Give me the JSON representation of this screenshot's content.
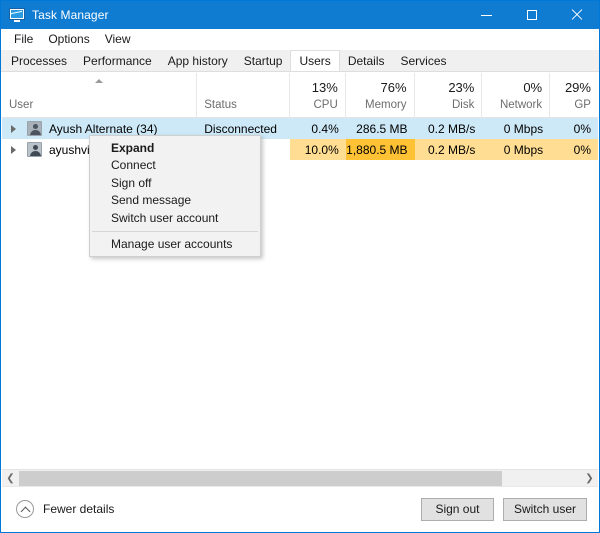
{
  "window": {
    "title": "Task Manager",
    "icon": "task-manager-icon",
    "controls": {
      "minimize": "minimize-icon",
      "maximize": "maximize-icon",
      "close": "close-icon"
    }
  },
  "menubar": {
    "items": [
      {
        "label": "File"
      },
      {
        "label": "Options"
      },
      {
        "label": "View"
      }
    ]
  },
  "tabs": {
    "active": "Users",
    "items": [
      {
        "label": "Processes"
      },
      {
        "label": "Performance"
      },
      {
        "label": "App history"
      },
      {
        "label": "Startup"
      },
      {
        "label": "Users"
      },
      {
        "label": "Details"
      },
      {
        "label": "Services"
      }
    ]
  },
  "table": {
    "sort_column": "User",
    "sort_direction": "ascending",
    "columns": [
      {
        "name": "User",
        "percent": ""
      },
      {
        "name": "Status",
        "percent": ""
      },
      {
        "name": "CPU",
        "percent": "13%"
      },
      {
        "name": "Memory",
        "percent": "76%"
      },
      {
        "name": "Disk",
        "percent": "23%"
      },
      {
        "name": "Network",
        "percent": "0%"
      },
      {
        "name": "GP",
        "percent": "29%"
      }
    ],
    "rows": [
      {
        "user": "Ayush Alternate (34)",
        "status": "Disconnected",
        "cpu": "0.4%",
        "memory": "286.5 MB",
        "disk": "0.2 MB/s",
        "network": "0 Mbps",
        "gpu": "0%",
        "selected": true,
        "expanded": false
      },
      {
        "user": "ayushvij",
        "status": "",
        "cpu": "10.0%",
        "memory": "1,880.5 MB",
        "disk": "0.2 MB/s",
        "network": "0 Mbps",
        "gpu": "0%",
        "selected": false,
        "expanded": false
      }
    ]
  },
  "context_menu": {
    "items": [
      {
        "label": "Expand",
        "bold": true
      },
      {
        "label": "Connect",
        "bold": false
      },
      {
        "label": "Sign off",
        "bold": false
      },
      {
        "label": "Send message",
        "bold": false
      },
      {
        "label": "Switch user account",
        "bold": false
      }
    ],
    "footer_item": {
      "label": "Manage user accounts"
    }
  },
  "statusbar": {
    "fewer_details": "Fewer details",
    "sign_out": "Sign out",
    "switch_user": "Switch user"
  },
  "colors": {
    "titlebar": "#0f7bd1",
    "selected_row": "#cde8f6",
    "heat_light": "#ffdd92",
    "heat_strong": "#ffc235",
    "accent": "#0078d7"
  }
}
